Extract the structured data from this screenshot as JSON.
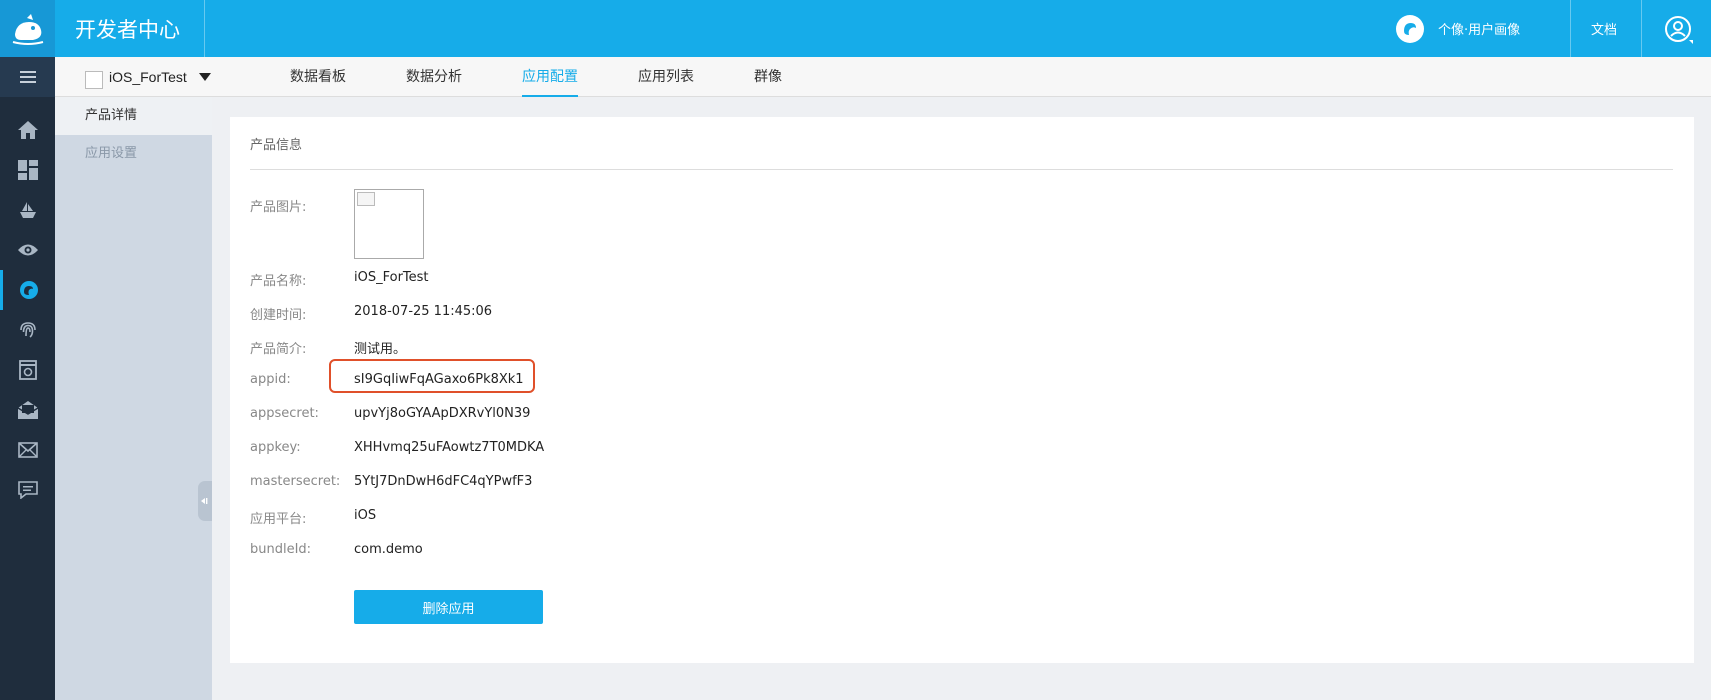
{
  "header": {
    "brand": "开发者中心",
    "product_label": "个像·用户画像",
    "docs_label": "文档"
  },
  "left_nav": {
    "icons": [
      "home-icon",
      "dashboard-icon",
      "boat-icon",
      "eye-icon",
      "product-icon",
      "fingerprint-icon",
      "screen-icon",
      "mail-open-icon",
      "mail-icon",
      "message-icon"
    ]
  },
  "app_selector": {
    "name": "iOS_ForTest"
  },
  "tabs": [
    {
      "label": "数据看板"
    },
    {
      "label": "数据分析"
    },
    {
      "label": "应用配置",
      "active": true
    },
    {
      "label": "应用列表"
    },
    {
      "label": "群像"
    }
  ],
  "sidebar": {
    "items": [
      {
        "label": "产品详情",
        "active": true
      },
      {
        "label": "应用设置"
      }
    ]
  },
  "card": {
    "title": "产品信息",
    "fields": {
      "image_label": "产品图片:",
      "name_label": "产品名称:",
      "name_value": "iOS_ForTest",
      "created_label": "创建时间:",
      "created_value": "2018-07-25 11:45:06",
      "intro_label": "产品简介:",
      "intro_value": "测试用。",
      "appid_label": "appid:",
      "appid_value": "sI9GqIiwFqAGaxo6Pk8Xk1",
      "appsecret_label": "appsecret:",
      "appsecret_value": "upvYj8oGYAApDXRvYl0N39",
      "appkey_label": "appkey:",
      "appkey_value": "XHHvmq25uFAowtz7T0MDKA",
      "mastersecret_label": "mastersecret:",
      "mastersecret_value": "5YtJ7DnDwH6dFC4qYPwfF3",
      "platform_label": "应用平台:",
      "platform_value": "iOS",
      "bundle_label": "bundleId:",
      "bundle_value": "com.demo"
    },
    "delete_button": "删除应用"
  },
  "colors": {
    "accent": "#16ace9",
    "nav_bg": "#1f2d3d",
    "highlight": "#e0502a"
  }
}
